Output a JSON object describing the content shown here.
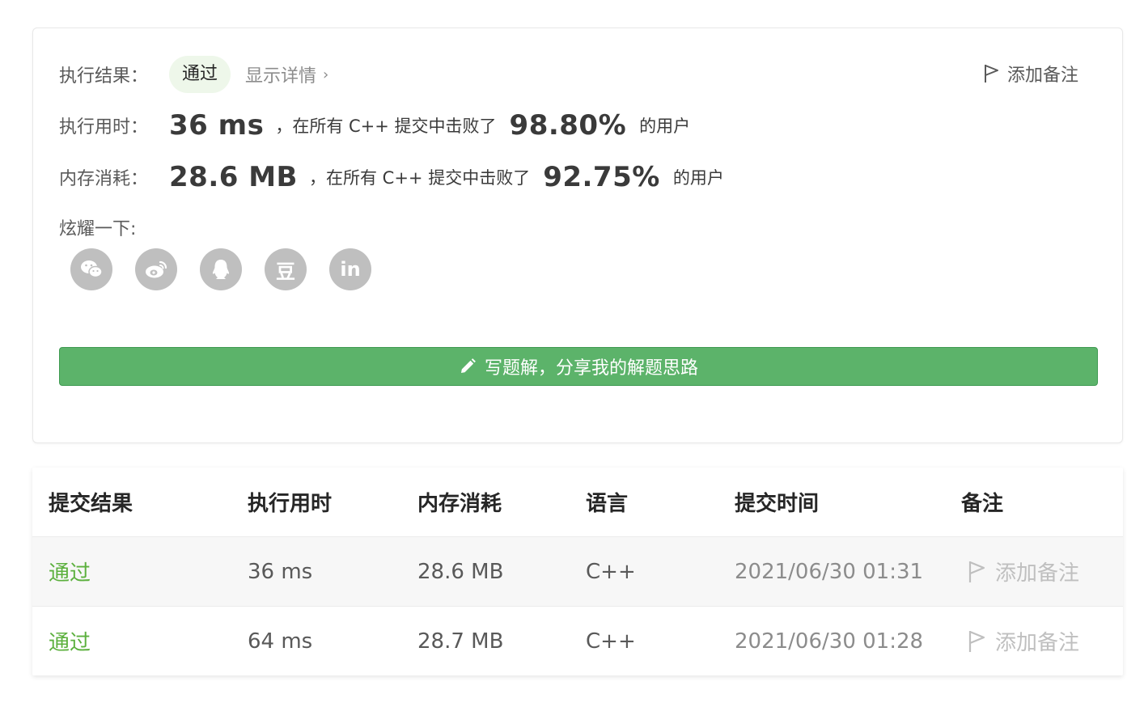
{
  "result": {
    "label": "执行结果：",
    "status": "通过",
    "details_link": "显示详情",
    "add_note": "添加备注"
  },
  "runtime": {
    "label": "执行用时：",
    "value": "36 ms",
    "text_before": "，在所有 C++ 提交中击败了",
    "percent": "98.80%",
    "text_after": "的用户"
  },
  "memory": {
    "label": "内存消耗：",
    "value": "28.6 MB",
    "text_before": "，在所有 C++ 提交中击败了",
    "percent": "92.75%",
    "text_after": "的用户"
  },
  "share": {
    "label": "炫耀一下:",
    "icons": [
      "wechat-icon",
      "weibo-icon",
      "qq-icon",
      "douban-icon",
      "linkedin-icon"
    ],
    "douban_glyph": "豆",
    "linkedin_glyph": "in"
  },
  "write_solution": {
    "label": "写题解，分享我的解题思路"
  },
  "submissions": {
    "headers": [
      "提交结果",
      "执行用时",
      "内存消耗",
      "语言",
      "提交时间",
      "备注"
    ],
    "rows": [
      {
        "status": "通过",
        "runtime": "36 ms",
        "memory": "28.6 MB",
        "lang": "C++",
        "time": "2021/06/30 01:31",
        "note": "添加备注"
      },
      {
        "status": "通过",
        "runtime": "64 ms",
        "memory": "28.7 MB",
        "lang": "C++",
        "time": "2021/06/30 01:28",
        "note": "添加备注"
      }
    ]
  },
  "colors": {
    "accent_green": "#5cb36a",
    "pass_text": "#5cb03e",
    "badge_bg": "#eef7ea",
    "icon_gray": "#bfbfbf"
  }
}
